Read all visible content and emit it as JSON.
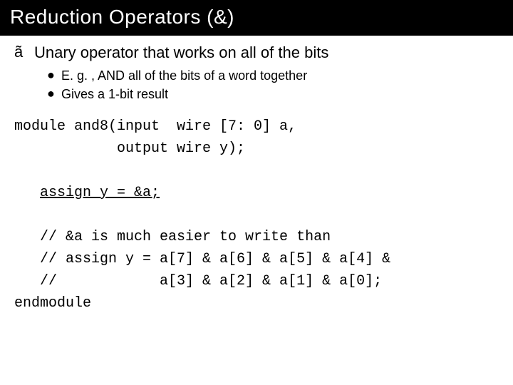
{
  "title": "Reduction Operators (&)",
  "top_bullet": {
    "glyph": "ã",
    "text": "Unary operator that works on all of the bits"
  },
  "sub_bullets": [
    "E. g. , AND all of the bits of a word together",
    "Gives a 1-bit result"
  ],
  "code": {
    "l1": "module and8(input  wire [7: 0] a,",
    "l2": "            output wire y);",
    "l3_indent": "   ",
    "l3_underlined": "assign y = &a;",
    "l4": "   // &a is much easier to write than",
    "l5": "   // assign y = a[7] & a[6] & a[5] & a[4] &",
    "l6": "   //            a[3] & a[2] & a[1] & a[0];",
    "l7": "endmodule"
  }
}
